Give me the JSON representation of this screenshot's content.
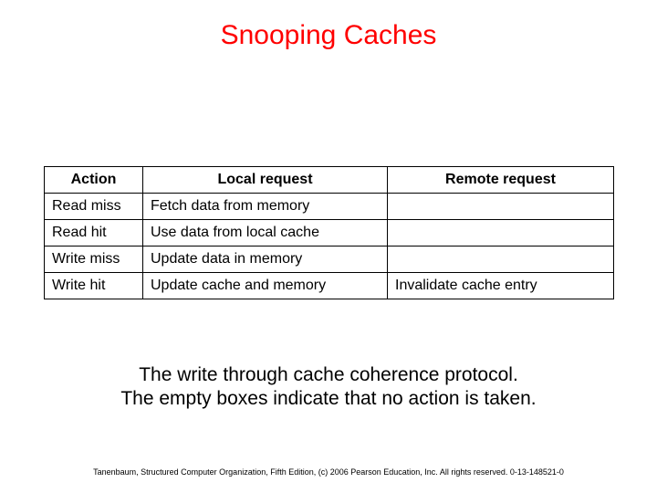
{
  "title": "Snooping Caches",
  "table": {
    "headers": [
      "Action",
      "Local request",
      "Remote request"
    ],
    "rows": [
      {
        "action": "Read miss",
        "local": "Fetch data from memory",
        "remote": ""
      },
      {
        "action": "Read hit",
        "local": "Use data from local cache",
        "remote": ""
      },
      {
        "action": "Write miss",
        "local": "Update data in memory",
        "remote": ""
      },
      {
        "action": "Write hit",
        "local": "Update cache and memory",
        "remote": "Invalidate cache entry"
      }
    ]
  },
  "caption_line1": "The write through cache coherence protocol.",
  "caption_line2": "The empty boxes indicate that no action is taken.",
  "footer": "Tanenbaum, Structured Computer Organization, Fifth Edition, (c) 2006 Pearson Education, Inc. All rights reserved. 0-13-148521-0"
}
